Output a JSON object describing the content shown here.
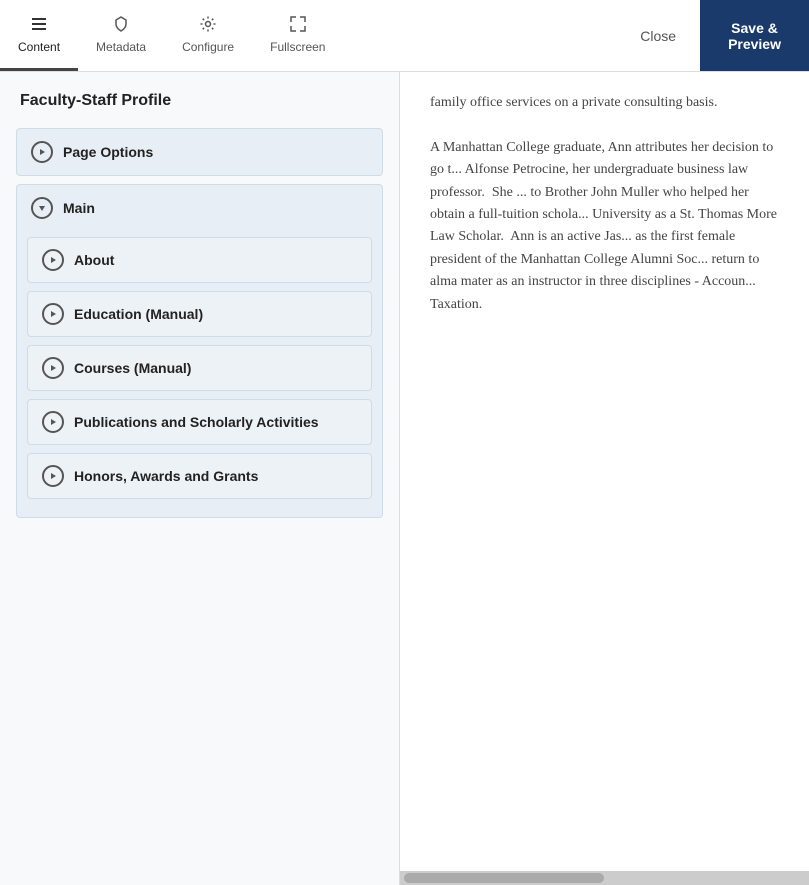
{
  "toolbar": {
    "tabs": [
      {
        "id": "content",
        "label": "Content",
        "icon": "☰",
        "active": true
      },
      {
        "id": "metadata",
        "label": "Metadata",
        "icon": "🏷",
        "active": false
      },
      {
        "id": "configure",
        "label": "Configure",
        "icon": "⚙",
        "active": false
      },
      {
        "id": "fullscreen",
        "label": "Fullscreen",
        "icon": "⛶",
        "active": false
      }
    ],
    "close_label": "Close",
    "save_label": "Save &\nPreview"
  },
  "left_panel": {
    "title": "Faculty-Staff Profile",
    "accordion_items": [
      {
        "id": "page-options",
        "label": "Page Options",
        "expanded": false,
        "icon_type": "right-arrow"
      },
      {
        "id": "main",
        "label": "Main",
        "expanded": true,
        "icon_type": "down-arrow",
        "sub_items": [
          {
            "id": "about",
            "label": "About",
            "expanded": false
          },
          {
            "id": "education",
            "label": "Education (Manual)",
            "expanded": false
          },
          {
            "id": "courses",
            "label": "Courses (Manual)",
            "expanded": false
          },
          {
            "id": "publications",
            "label": "Publications and Scholarly Activities",
            "expanded": false
          },
          {
            "id": "honors",
            "label": "Honors, Awards and Grants",
            "expanded": false
          }
        ]
      }
    ]
  },
  "preview": {
    "paragraphs": [
      "family office services on a private consulting basis.",
      "A Manhattan College graduate, Ann attributes her decision to go t... Alfonse Petrocine, her undergraduate business law professor.  She ... to Brother John Muller who helped her obtain a full-tuition schola... University as a St. Thomas More Law Scholar.  Ann is an active Jas... as the first female president of the Manhattan College Alumni Soc... return to alma mater as an instructor in three disciplines - Accoun... Taxation."
    ]
  },
  "icons": {
    "content": "≡",
    "metadata": "◇",
    "configure": "⚙",
    "fullscreen": "⛶",
    "right_arrow": "▶",
    "down_arrow": "▼"
  }
}
